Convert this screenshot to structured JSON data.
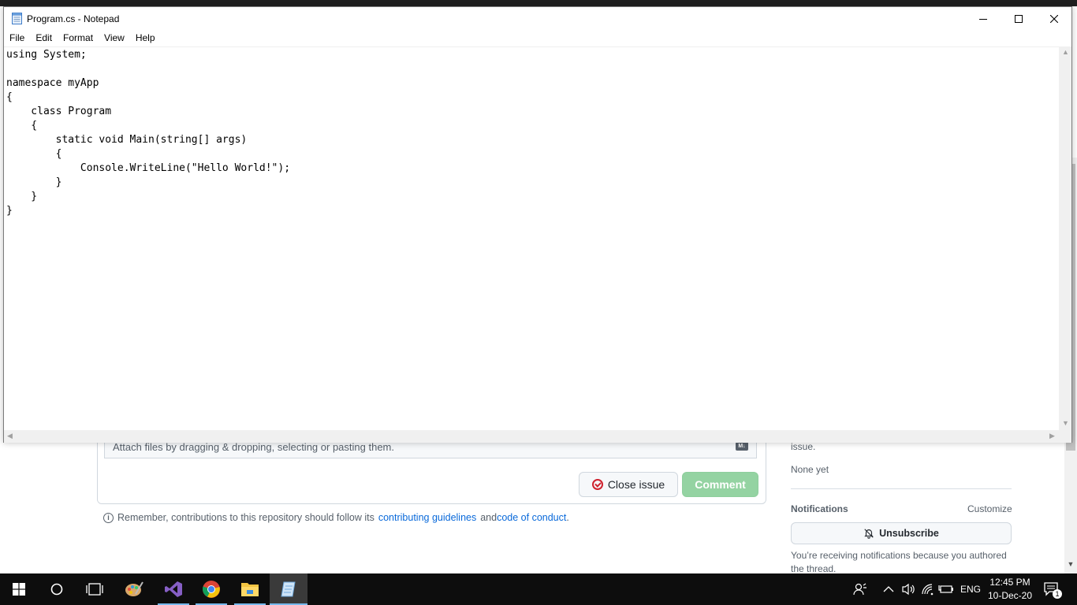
{
  "window": {
    "title": "Program.cs - Notepad",
    "menu": [
      "File",
      "Edit",
      "Format",
      "View",
      "Help"
    ]
  },
  "editor": {
    "content": "using System;\n\nnamespace myApp\n{\n    class Program\n    {\n        static void Main(string[] args)\n        {\n            Console.WriteLine(\"Hello World!\");\n        }\n    }\n}"
  },
  "background_page": {
    "attach_text": "Attach files by dragging & dropping, selecting or pasting them.",
    "markdown_badge": "M↓",
    "close_issue_label": "Close issue",
    "comment_label": "Comment",
    "note_prefix": "Remember, contributions to this repository should follow its",
    "note_link1": "contributing guidelines",
    "note_and": "and",
    "note_link2": "code of conduct",
    "note_suffix": ".",
    "sidebar": {
      "issue_tail": "issue.",
      "none_yet": "None yet",
      "notifications_label": "Notifications",
      "customize_label": "Customize",
      "unsubscribe_label": "Unsubscribe",
      "receiving_text": "You’re receiving notifications because you authored the thread."
    }
  },
  "taskbar": {
    "language": "ENG",
    "time": "12:45 PM",
    "date": "10-Dec-20",
    "notification_count": "1"
  },
  "colors": {
    "taskbar_bg": "#0d0d0d",
    "taskbar_accent": "#76b9ed",
    "comment_button": "#94d3a2",
    "link": "#0969da",
    "close_icon": "#cf222e"
  }
}
